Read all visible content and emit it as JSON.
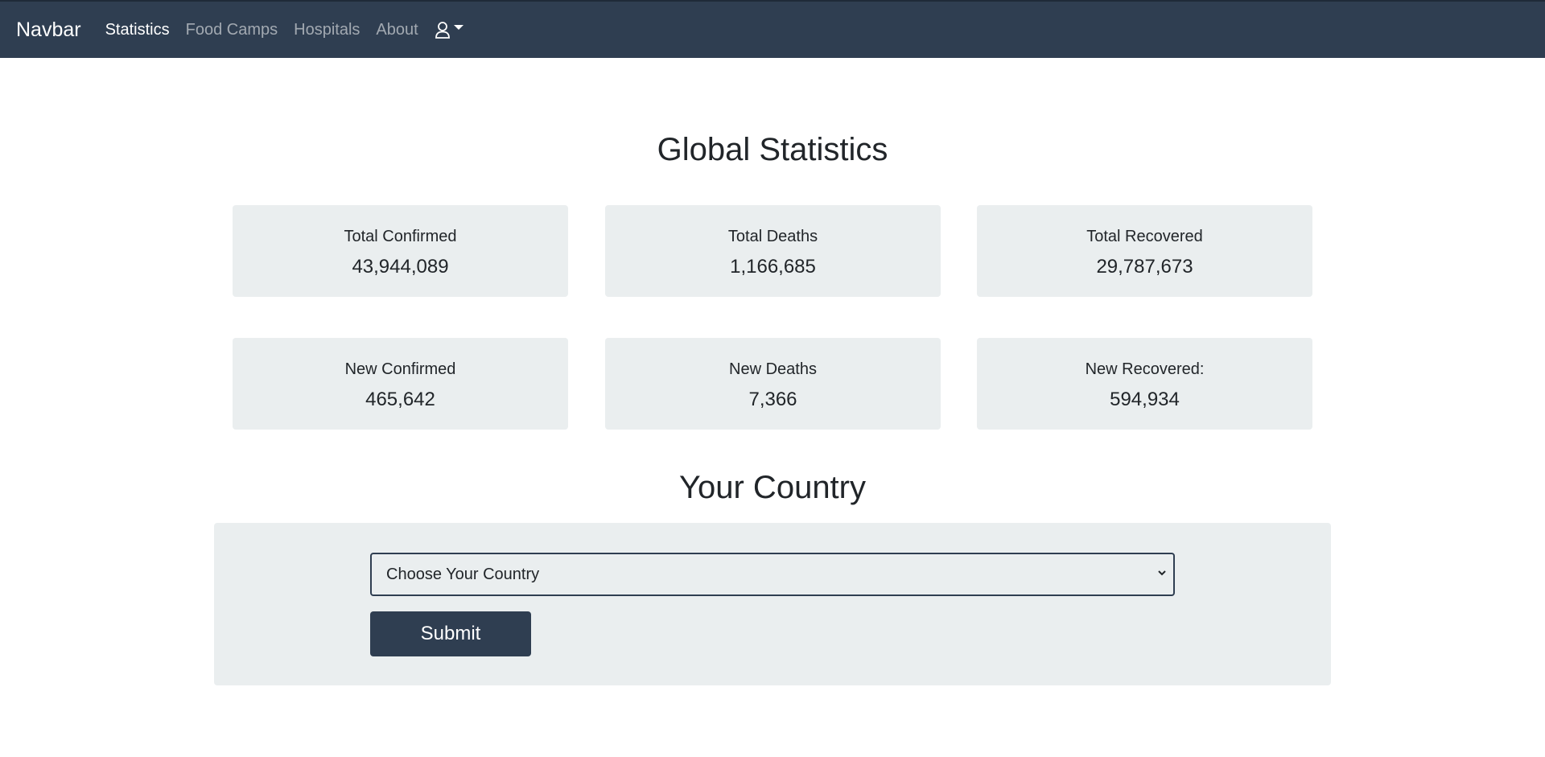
{
  "navbar": {
    "brand": "Navbar",
    "links": [
      {
        "label": "Statistics",
        "active": true
      },
      {
        "label": "Food Camps",
        "active": false
      },
      {
        "label": "Hospitals",
        "active": false
      },
      {
        "label": "About",
        "active": false
      }
    ],
    "user_icon": "user-icon",
    "background": "#2f3e51"
  },
  "global": {
    "title": "Global Statistics",
    "stats": [
      {
        "label": "Total Confirmed",
        "value": "43,944,089"
      },
      {
        "label": "Total Deaths",
        "value": "1,166,685"
      },
      {
        "label": "Total Recovered",
        "value": "29,787,673"
      },
      {
        "label": "New Confirmed",
        "value": "465,642"
      },
      {
        "label": "New Deaths",
        "value": "7,366"
      },
      {
        "label": "New Recovered:",
        "value": "594,934"
      }
    ]
  },
  "country": {
    "title": "Your Country",
    "select_value": "Choose Your Country",
    "submit_label": "Submit"
  }
}
